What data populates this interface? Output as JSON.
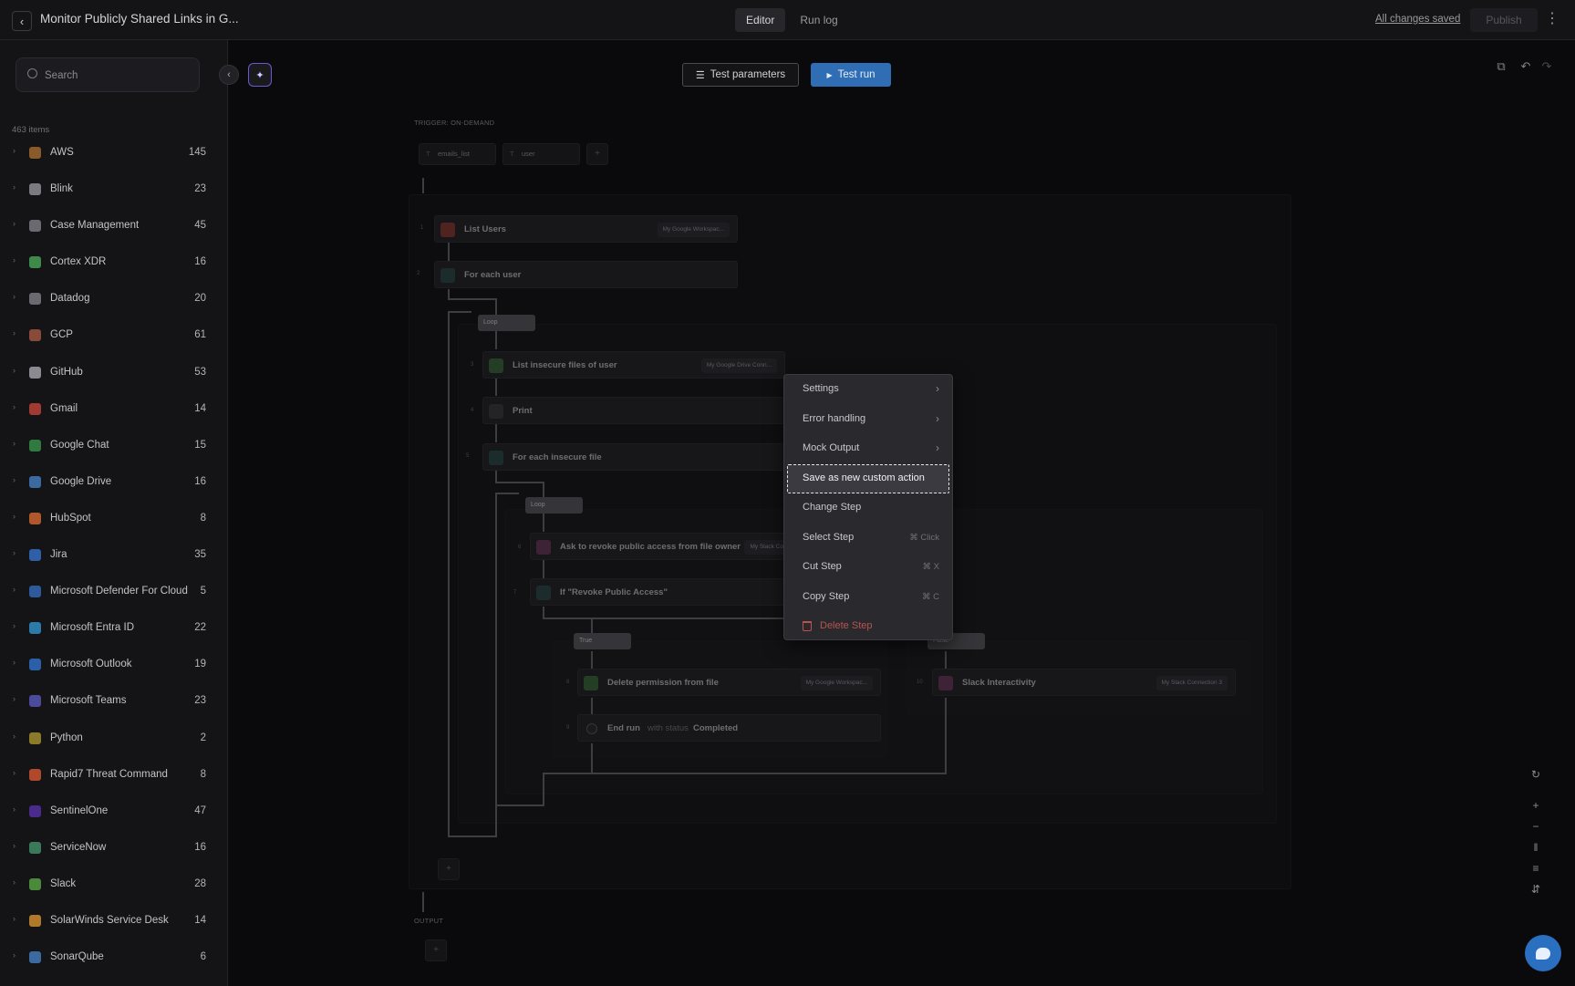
{
  "header": {
    "title": "Monitor Publicly Shared Links in G...",
    "tabs": [
      {
        "label": "Editor",
        "active": true
      },
      {
        "label": "Run log",
        "active": false
      }
    ],
    "saved_status": "All changes saved",
    "publish_label": "Publish"
  },
  "sidebar": {
    "search_placeholder": "Search",
    "items_count": "463 items",
    "categories": [
      {
        "name": "AWS",
        "count": "145",
        "color": "#8a5a2a"
      },
      {
        "name": "Blink",
        "count": "23",
        "color": "#7a7a80"
      },
      {
        "name": "Case Management",
        "count": "45",
        "color": "#6a6a70"
      },
      {
        "name": "Cortex XDR",
        "count": "16",
        "color": "#3d8a4a"
      },
      {
        "name": "Datadog",
        "count": "20",
        "color": "#6a6a70"
      },
      {
        "name": "GCP",
        "count": "61",
        "color": "#8a4a3a"
      },
      {
        "name": "GitHub",
        "count": "53",
        "color": "#8a8a90"
      },
      {
        "name": "Gmail",
        "count": "14",
        "color": "#a03a32"
      },
      {
        "name": "Google Chat",
        "count": "15",
        "color": "#2f7a3f"
      },
      {
        "name": "Google Drive",
        "count": "16",
        "color": "#3a6aa0"
      },
      {
        "name": "HubSpot",
        "count": "8",
        "color": "#b0582c"
      },
      {
        "name": "Jira",
        "count": "35",
        "color": "#2e5fa8"
      },
      {
        "name": "Microsoft Defender For Cloud",
        "count": "5",
        "color": "#2c5a9a"
      },
      {
        "name": "Microsoft Entra ID",
        "count": "22",
        "color": "#2c7aaa"
      },
      {
        "name": "Microsoft Outlook",
        "count": "19",
        "color": "#2a60a8"
      },
      {
        "name": "Microsoft Teams",
        "count": "23",
        "color": "#4c4a9a"
      },
      {
        "name": "Python",
        "count": "2",
        "color": "#8a7a2a"
      },
      {
        "name": "Rapid7 Threat Command",
        "count": "8",
        "color": "#b0482c"
      },
      {
        "name": "SentinelOne",
        "count": "47",
        "color": "#4a2a8a"
      },
      {
        "name": "ServiceNow",
        "count": "16",
        "color": "#3a7a5a"
      },
      {
        "name": "Slack",
        "count": "28",
        "color": "#4a8a3a"
      },
      {
        "name": "SolarWinds Service Desk",
        "count": "14",
        "color": "#b07a2a"
      },
      {
        "name": "SonarQube",
        "count": "6",
        "color": "#3a6aa0"
      }
    ]
  },
  "toolbar": {
    "test_params_label": "Test parameters",
    "test_run_label": "Test run"
  },
  "workflow": {
    "trigger_label": "TRIGGER: ON-DEMAND",
    "params": [
      "emails_list",
      "user"
    ],
    "output_label": "OUTPUT",
    "nodes": {
      "list_users": {
        "num": "1",
        "label": "List Users",
        "conn": "My Google Workspac..."
      },
      "for_each_user": {
        "num": "2",
        "label": "For each user"
      },
      "loop1": "Loop",
      "list_insecure": {
        "num": "3",
        "label": "List insecure files of user",
        "conn": "My Google Drive Conn..."
      },
      "print": {
        "num": "4",
        "label": "Print"
      },
      "for_each_file": {
        "num": "5",
        "label": "For each insecure file"
      },
      "loop2": "Loop",
      "ask_revoke": {
        "num": "6",
        "label": "Ask to revoke public access from file owner",
        "conn": "My Slack Con..."
      },
      "if_revoke": {
        "num": "7",
        "label": "If \"Revoke Public Access\""
      },
      "true_chip": "True",
      "false_chip": "False",
      "delete_perm": {
        "num": "8",
        "label": "Delete permission from file",
        "conn": "My Google Workspac..."
      },
      "end_run": {
        "num": "9",
        "label": "End run",
        "mid": "with status",
        "status": "Completed"
      },
      "slack_inter": {
        "num": "10",
        "label": "Slack Interactivity",
        "conn": "My Slack Connection 3"
      }
    }
  },
  "context_menu": {
    "items": [
      {
        "label": "Settings",
        "submenu": true
      },
      {
        "label": "Error handling",
        "submenu": true
      },
      {
        "label": "Mock Output",
        "submenu": true
      },
      {
        "label": "Save as new custom action",
        "highlighted": true
      },
      {
        "label": "Change Step"
      },
      {
        "label": "Select Step",
        "shortcut": "⌘ Click"
      },
      {
        "label": "Cut Step",
        "shortcut": "⌘ X"
      },
      {
        "label": "Copy Step",
        "shortcut": "⌘ C"
      },
      {
        "label": "Delete Step",
        "danger": true
      }
    ]
  }
}
